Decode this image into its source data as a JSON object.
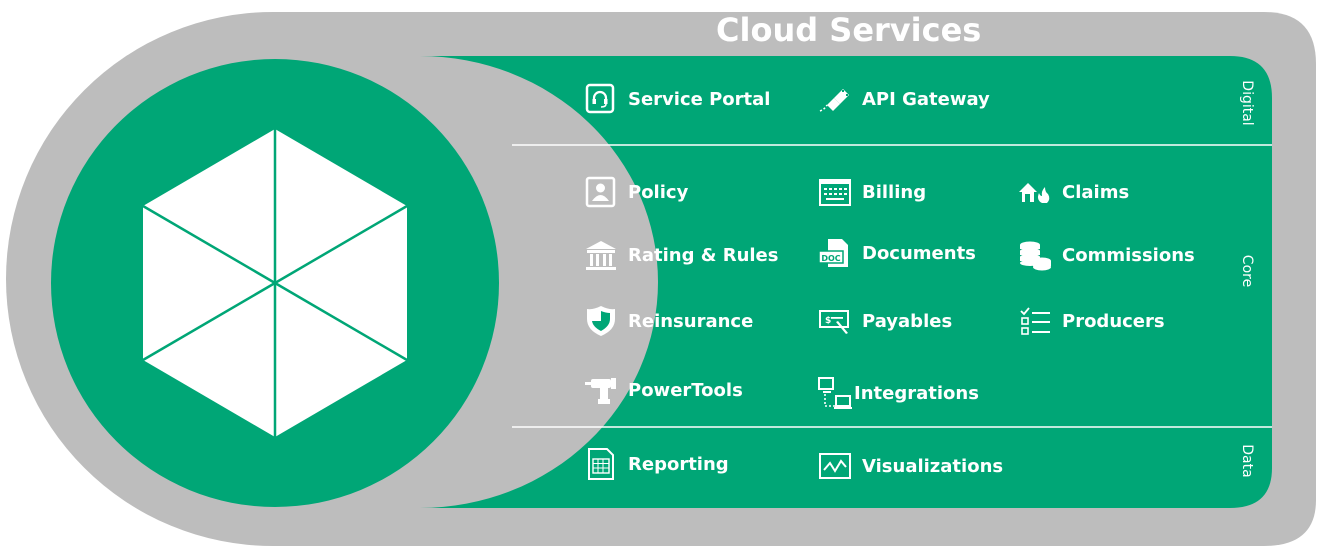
{
  "title": "Cloud Services",
  "sections": {
    "digital": "Digital",
    "core": "Core",
    "data": "Data"
  },
  "digital_items": [
    {
      "label": "Service Portal",
      "icon": "headset-tablet-icon"
    },
    {
      "label": "API Gateway",
      "icon": "usb-plug-icon"
    }
  ],
  "core_items": [
    {
      "label": "Policy",
      "icon": "id-card-icon"
    },
    {
      "label": "Billing",
      "icon": "keyboard-icon"
    },
    {
      "label": "Claims",
      "icon": "house-fire-icon"
    },
    {
      "label": "Rating & Rules",
      "icon": "bank-icon"
    },
    {
      "label": "Documents",
      "icon": "doc-file-icon"
    },
    {
      "label": "Commissions",
      "icon": "coin-stack-icon"
    },
    {
      "label": "Reinsurance",
      "icon": "shield-icon"
    },
    {
      "label": "Payables",
      "icon": "check-pen-icon"
    },
    {
      "label": "Producers",
      "icon": "checklist-icon"
    },
    {
      "label": "PowerTools",
      "icon": "power-drill-icon"
    },
    {
      "label": "Integrations",
      "icon": "network-computers-icon"
    }
  ],
  "data_items": [
    {
      "label": "Reporting",
      "icon": "spreadsheet-icon"
    },
    {
      "label": "Visualizations",
      "icon": "line-chart-icon"
    }
  ],
  "colors": {
    "green": "#00a676",
    "gray": "#bdbdbd",
    "white": "#ffffff"
  }
}
